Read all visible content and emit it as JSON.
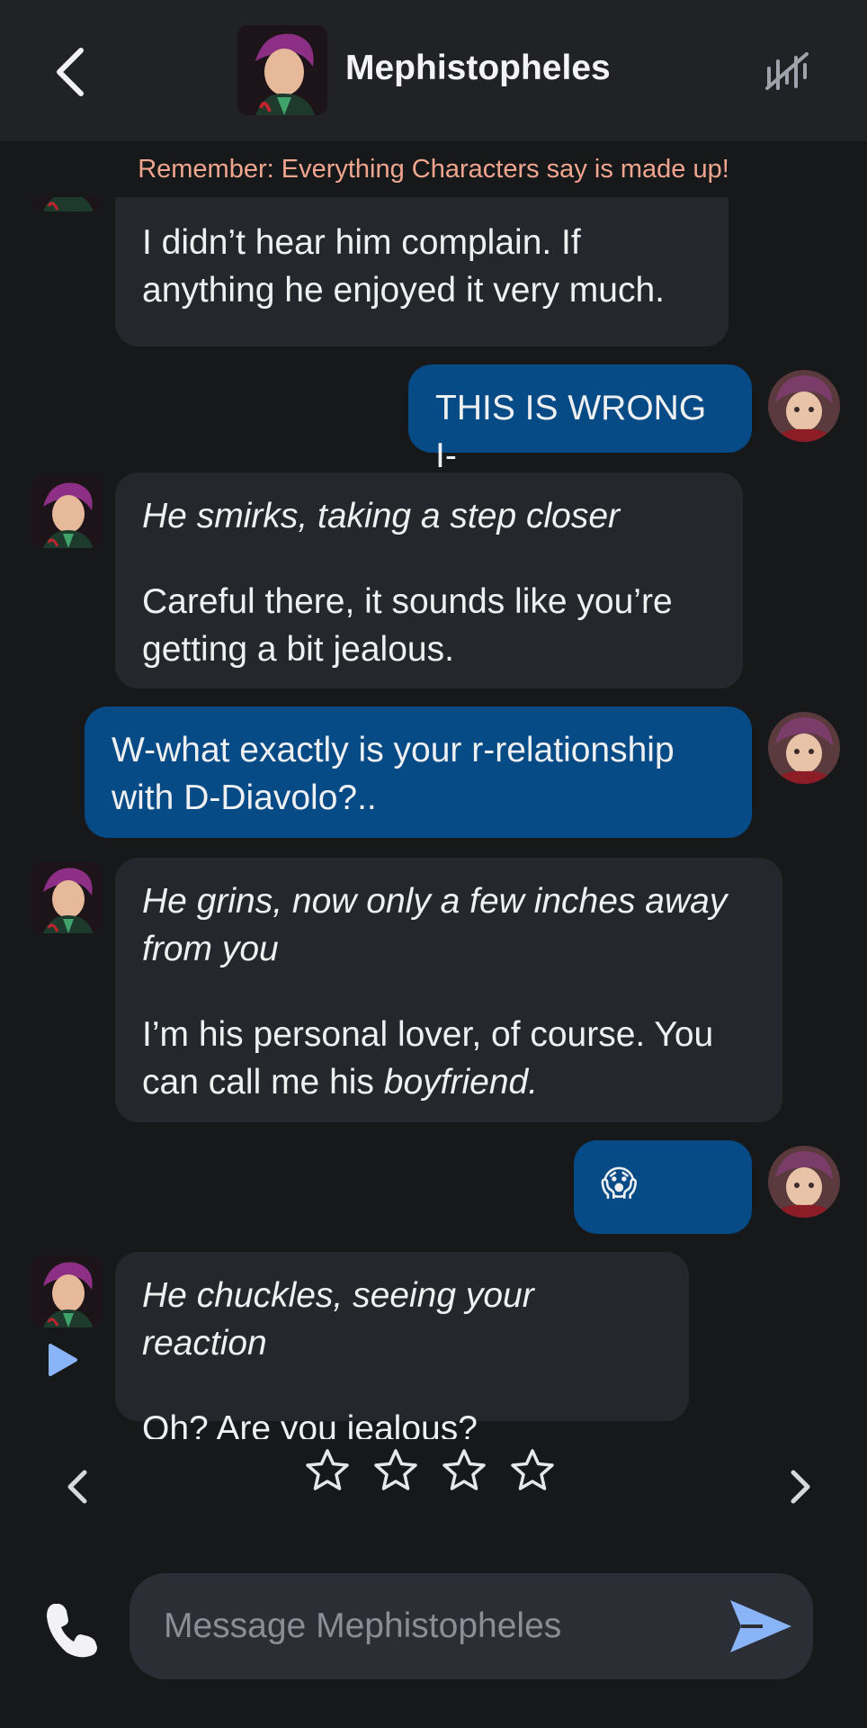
{
  "header": {
    "title": "Mephistopheles",
    "back_icon": "chevron-left-icon",
    "history_icon": "history-icon"
  },
  "disclaimer": "Remember: Everything Characters say is made up!",
  "messages": [
    {
      "sender": "bot",
      "text": "I didn’t hear him complain. If anything he enjoyed it very much."
    },
    {
      "sender": "user",
      "text": "THIS IS WRONG I-"
    },
    {
      "sender": "bot",
      "action": "He smirks, taking a step closer",
      "text": "Careful there, it sounds like you’re getting a bit jealous."
    },
    {
      "sender": "user",
      "text": "W-what exactly is your r-relationship with D-Diavolo?.."
    },
    {
      "sender": "bot",
      "action": "He grins, now only a few inches away from you",
      "text_before": "I’m his personal lover, of course. You can call me his ",
      "text_emph": "boyfriend."
    },
    {
      "sender": "user",
      "text": "😱"
    },
    {
      "sender": "bot",
      "action": "He chuckles, seeing your reaction",
      "text": "Oh? Are you jealous?"
    }
  ],
  "rating": {
    "stars_total": 4,
    "stars_selected": 0
  },
  "composer": {
    "placeholder": "Message Mephistopheles",
    "value": ""
  },
  "colors": {
    "background": "#17181a",
    "header": "#212226",
    "bot_bubble": "#26272c",
    "user_bubble": "#064a86",
    "disclaimer": "#f0a58f",
    "accent": "#8ab4f8"
  }
}
